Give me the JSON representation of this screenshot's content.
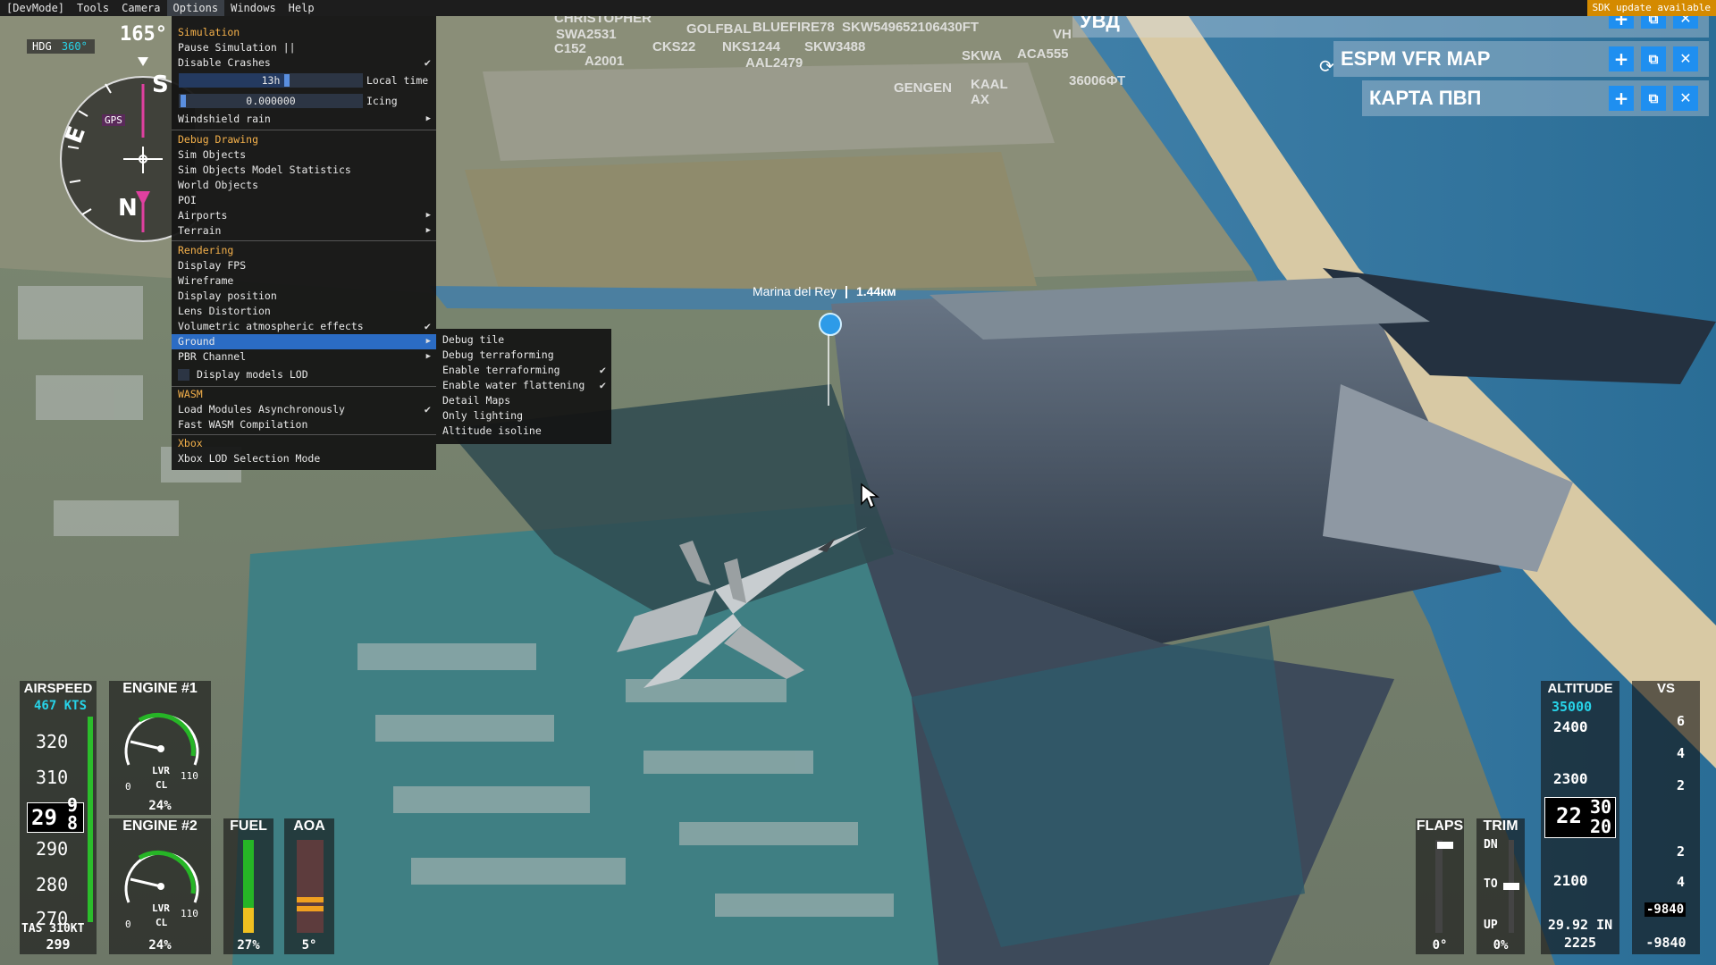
{
  "menubar": {
    "items": [
      "[DevMode]",
      "Tools",
      "Camera",
      "Options",
      "Windows",
      "Help"
    ],
    "active": "Options",
    "sdk_badge": "SDK update available"
  },
  "options_menu": {
    "simulation_header": "Simulation",
    "pause": "Pause Simulation ||",
    "disable_crashes": "Disable Crashes",
    "local_time_value": "13h",
    "local_time_label": "Local time",
    "icing_value": "0.000000",
    "icing_label": "Icing",
    "windshield_rain": "Windshield rain",
    "debug_header": "Debug Drawing",
    "sim_objects": "Sim Objects",
    "sim_objects_stats": "Sim Objects Model Statistics",
    "world_objects": "World Objects",
    "poi": "POI",
    "airports": "Airports",
    "terrain": "Terrain",
    "rendering_header": "Rendering",
    "display_fps": "Display FPS",
    "wireframe": "Wireframe",
    "display_position": "Display position",
    "lens_distortion": "Lens Distortion",
    "volumetric": "Volumetric atmospheric effects",
    "ground": "Ground",
    "pbr_channel": "PBR Channel",
    "display_models_lod": "Display models LOD",
    "wasm_header": "WASM",
    "load_modules": "Load Modules Asynchronously",
    "fast_wasm": "Fast WASM Compilation",
    "xbox_header": "Xbox",
    "xbox_lod": "Xbox LOD Selection Mode"
  },
  "ground_submenu": {
    "debug_tile": "Debug tile",
    "debug_terraforming": "Debug terraforming",
    "enable_terraforming": "Enable terraforming",
    "enable_water_flattening": "Enable water flattening",
    "detail_maps": "Detail Maps",
    "only_lighting": "Only lighting",
    "altitude_isoline": "Altitude isoline"
  },
  "panels": {
    "uvd_title": "УВД",
    "vfr_title": "ESPM VFR MAP",
    "pvp_title": "КАРТА ПВП"
  },
  "world_labels": {
    "marina": "Marina del Rey",
    "distance": "1.44км",
    "callsigns": [
      "CHRISTOPHER",
      "SWA2531",
      "GOLFBAL",
      "BLUEFIRE78",
      "SKW5496",
      "C152",
      "A2001",
      "CKS22",
      "NKS1244",
      "SKW3488",
      "AAL2479",
      "52106430FT",
      "SKWA",
      "ACA555",
      "GENGEN",
      "KAAL AX",
      "36006ФТ",
      "VH"
    ]
  },
  "compass": {
    "heading": "165°",
    "hdg_label": "HDG",
    "hdg_value": "360°",
    "gps_label": "GPS",
    "cardinals": [
      "S",
      "E",
      "N"
    ]
  },
  "airspeed": {
    "title": "AIRSPEED",
    "selected": "467 KTS",
    "ticks": [
      "320",
      "310",
      "290",
      "280",
      "270"
    ],
    "current": "29",
    "current_roll": [
      "9",
      "8"
    ],
    "tas_label": "TAS 310KT",
    "bottom": "299"
  },
  "engine1": {
    "title": "ENGINE #1",
    "lvr": "LVR",
    "cl": "CL",
    "min": "0",
    "max": "110",
    "percent": "24%"
  },
  "engine2": {
    "title": "ENGINE #2",
    "lvr": "LVR",
    "cl": "CL",
    "min": "0",
    "max": "110",
    "percent": "24%"
  },
  "fuel": {
    "title": "FUEL",
    "value": "27%",
    "level": 0.27
  },
  "aoa": {
    "title": "AOA",
    "value": "5°"
  },
  "flaps": {
    "title": "FLAPS",
    "value": "0°"
  },
  "trim": {
    "title": "TRIM",
    "dn": "DN",
    "to": "TO",
    "up": "UP",
    "value": "0%"
  },
  "altitude": {
    "title": "ALTITUDE",
    "selected": "35000",
    "ticks": [
      "2400",
      "2300",
      "2100"
    ],
    "current_big": "22",
    "current_roll": [
      "30",
      "20"
    ],
    "baro": "29.92 IN",
    "bottom": "2225"
  },
  "vs": {
    "title": "VS",
    "ticks": [
      "6",
      "4",
      "2",
      "2",
      "4"
    ],
    "bug": "-9840",
    "bottom": "-9840"
  }
}
